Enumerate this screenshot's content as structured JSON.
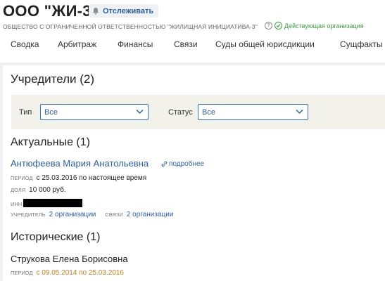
{
  "header": {
    "title": "ООО \"ЖИ-3\"",
    "track_label": "Отслеживать",
    "full_name": "ОБЩЕСТВО С ОГРАНИЧЕННОЙ ОТВЕТСТВЕННОСТЬЮ \"ЖИЛИЩНАЯ ИНИЦИАТИВА-3\"",
    "info_glyph": "?",
    "status_label": "Действующая организация",
    "status_color": "#3aa03a"
  },
  "tabs": [
    "Сводка",
    "Арбитраж",
    "Финансы",
    "Связи",
    "Суды общей юрисдикции",
    "Сущфакты"
  ],
  "founders": {
    "heading": "Учредители (2)",
    "filters": {
      "type_label": "Тип",
      "type_value": "Все",
      "status_label": "Статус",
      "status_value": "Все"
    },
    "current": {
      "heading": "Актуальные (1)",
      "name": "Антюфеева Мария Анатольевна",
      "more_label": "подробнее",
      "period_label": "период",
      "period_value": "с 25.03.2016 по настоящее время",
      "share_label": "доля",
      "share_value": "10 000 руб.",
      "inn_label": "инн",
      "founder_label": "учредитель",
      "founder_value": "2 организации",
      "links_label": "связи",
      "links_value": "2 организации"
    },
    "historical": {
      "heading": "Исторические (1)",
      "name": "Струкова Елена Борисовна",
      "period_label": "период",
      "period_value": "с 09.05.2014 по 25.03.2016"
    }
  },
  "colors": {
    "accent": "#2b5fad",
    "historical_period": "#d17b14",
    "filter_bg": "#f2f2ea",
    "page_bg": "#eef0f3"
  }
}
